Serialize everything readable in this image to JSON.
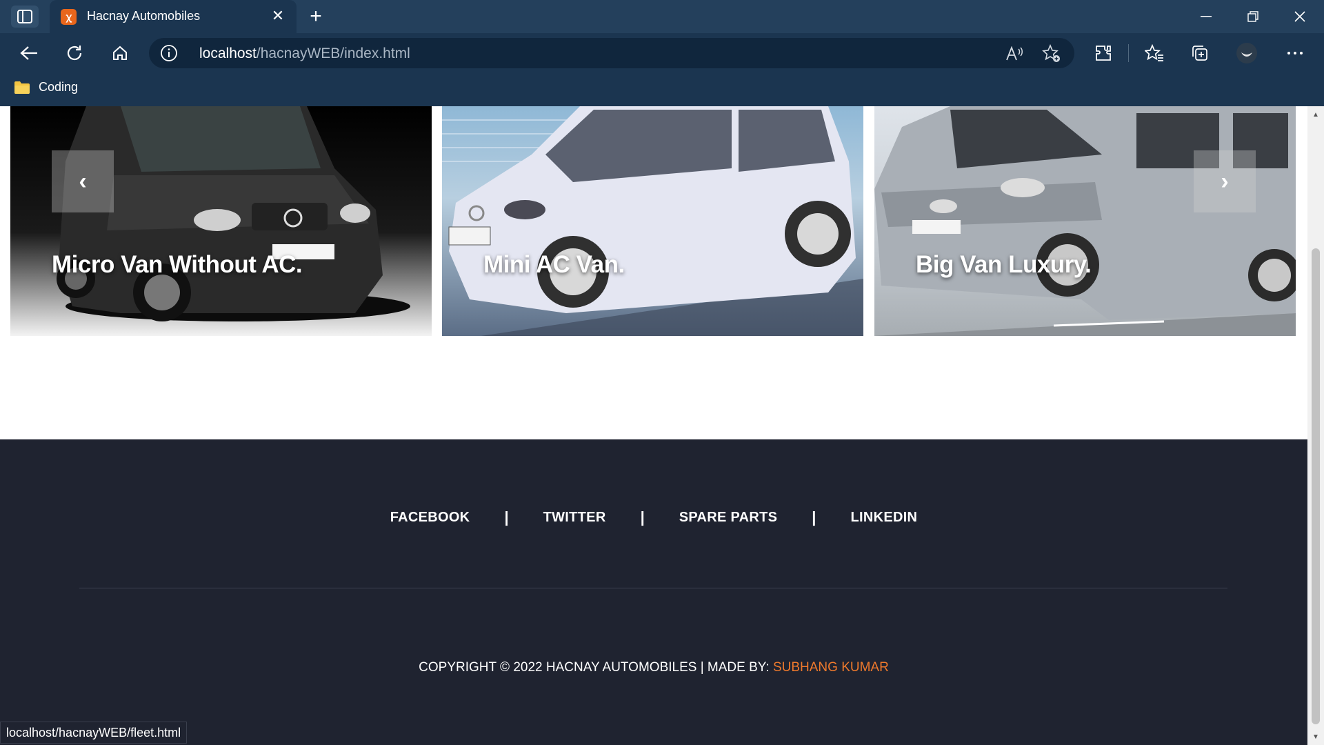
{
  "browser": {
    "tab_title": "Hacnay Automobiles",
    "tab_favicon": "xampp-icon",
    "url_host": "localhost",
    "url_path": "/hacnayWEB/index.html",
    "bookmark_folder": "Coding",
    "status_url": "localhost/hacnayWEB/fleet.html"
  },
  "carousel": {
    "slides": [
      {
        "caption": "Micro Van Without AC.",
        "color": "#1d1d1d"
      },
      {
        "caption": "Mini AC Van.",
        "color": "#c9cde0"
      },
      {
        "caption": "Big Van Luxury.",
        "color": "#9aa0a8"
      }
    ],
    "prev_label": "‹",
    "next_label": "›"
  },
  "footer": {
    "links": [
      "FACEBOOK",
      "TWITTER",
      "SPARE PARTS",
      "LINKEDIN"
    ],
    "separator": "|",
    "copyright_text": "COPYRIGHT © 2022 HACNAY AUTOMOBILES | MADE BY: ",
    "author": "SUBHANG KUMAR"
  },
  "colors": {
    "chrome": "#1b3550",
    "footer_bg": "#1f2330",
    "author_accent": "#f07a2c"
  }
}
